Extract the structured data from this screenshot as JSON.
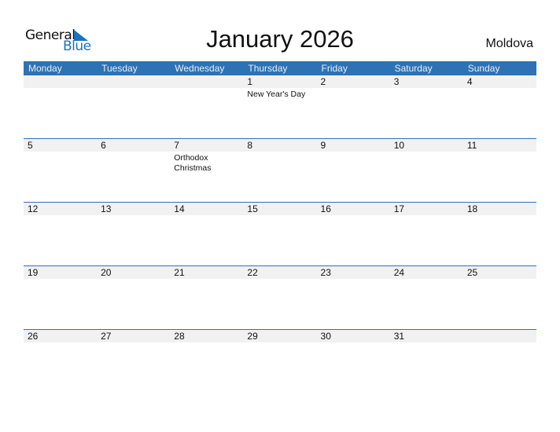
{
  "logo": {
    "word1": "General",
    "word2": "Blue"
  },
  "title": "January 2026",
  "country": "Moldova",
  "colors": {
    "header": "#2e72b4",
    "brand_blue": "#1a73c0",
    "day_strip": "#f1f1f1"
  },
  "weekdays": [
    "Monday",
    "Tuesday",
    "Wednesday",
    "Thursday",
    "Friday",
    "Saturday",
    "Sunday"
  ],
  "weeks": [
    {
      "days": [
        {
          "n": "",
          "e": ""
        },
        {
          "n": "",
          "e": ""
        },
        {
          "n": "",
          "e": ""
        },
        {
          "n": "1",
          "e": "New Year's Day"
        },
        {
          "n": "2",
          "e": ""
        },
        {
          "n": "3",
          "e": ""
        },
        {
          "n": "4",
          "e": ""
        }
      ]
    },
    {
      "days": [
        {
          "n": "5",
          "e": ""
        },
        {
          "n": "6",
          "e": ""
        },
        {
          "n": "7",
          "e": "Orthodox Christmas"
        },
        {
          "n": "8",
          "e": ""
        },
        {
          "n": "9",
          "e": ""
        },
        {
          "n": "10",
          "e": ""
        },
        {
          "n": "11",
          "e": ""
        }
      ]
    },
    {
      "days": [
        {
          "n": "12",
          "e": ""
        },
        {
          "n": "13",
          "e": ""
        },
        {
          "n": "14",
          "e": ""
        },
        {
          "n": "15",
          "e": ""
        },
        {
          "n": "16",
          "e": ""
        },
        {
          "n": "17",
          "e": ""
        },
        {
          "n": "18",
          "e": ""
        }
      ]
    },
    {
      "days": [
        {
          "n": "19",
          "e": ""
        },
        {
          "n": "20",
          "e": ""
        },
        {
          "n": "21",
          "e": ""
        },
        {
          "n": "22",
          "e": ""
        },
        {
          "n": "23",
          "e": ""
        },
        {
          "n": "24",
          "e": ""
        },
        {
          "n": "25",
          "e": ""
        }
      ]
    },
    {
      "days": [
        {
          "n": "26",
          "e": ""
        },
        {
          "n": "27",
          "e": ""
        },
        {
          "n": "28",
          "e": ""
        },
        {
          "n": "29",
          "e": ""
        },
        {
          "n": "30",
          "e": ""
        },
        {
          "n": "31",
          "e": ""
        },
        {
          "n": "",
          "e": ""
        }
      ]
    }
  ]
}
